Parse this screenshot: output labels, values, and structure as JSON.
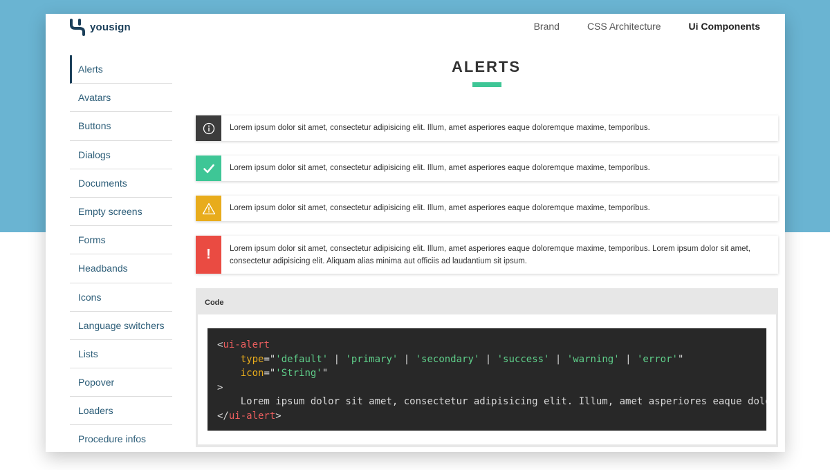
{
  "header": {
    "logo_text": "yousign",
    "nav": [
      "Brand",
      "CSS Architecture",
      "Ui Components"
    ]
  },
  "sidebar": {
    "items": [
      "Alerts",
      "Avatars",
      "Buttons",
      "Dialogs",
      "Documents",
      "Empty screens",
      "Forms",
      "Headbands",
      "Icons",
      "Language switchers",
      "Lists",
      "Popover",
      "Loaders",
      "Procedure infos"
    ]
  },
  "main": {
    "title": "ALERTS",
    "alerts": [
      {
        "type": "default",
        "icon": "info-icon",
        "text": "Lorem ipsum dolor sit amet, consectetur adipisicing elit. Illum, amet asperiores eaque doloremque maxime, temporibus."
      },
      {
        "type": "success",
        "icon": "check-icon",
        "text": "Lorem ipsum dolor sit amet, consectetur adipisicing elit. Illum, amet asperiores eaque doloremque maxime, temporibus."
      },
      {
        "type": "warning",
        "icon": "warning-icon",
        "text": "Lorem ipsum dolor sit amet, consectetur adipisicing elit. Illum, amet asperiores eaque doloremque maxime, temporibus."
      },
      {
        "type": "error",
        "icon": "exclamation-icon",
        "icon_glyph": "!",
        "text": "Lorem ipsum dolor sit amet, consectetur adipisicing elit. Illum, amet asperiores eaque doloremque maxime, temporibus. Lorem ipsum dolor sit amet, consectetur adipisicing elit. Aliquam alias minima aut officiis ad laudantium sit ipsum."
      }
    ],
    "code": {
      "label": "Code",
      "open_tag_start": "<",
      "tag_name": "ui-alert",
      "attr_type": "type",
      "type_eq": "=\"",
      "type_values": [
        "'default'",
        "'primary'",
        "'secondary'",
        "'success'",
        "'warning'",
        "'error'"
      ],
      "separator": " | ",
      "type_end": "\"",
      "attr_icon": "icon",
      "icon_eq": "=\"",
      "icon_value": "'String'",
      "icon_end": "\"",
      "open_tag_end": ">",
      "body": "Lorem ipsum dolor sit amet, consectetur adipisicing elit. Illum, amet asperiores eaque doloremque maxime, temporibus.",
      "close_tag_start": "</",
      "close_tag_end": ">"
    }
  },
  "colors": {
    "accent": "#3ec696",
    "brand": "#1b3f5a",
    "default": "#3c3c3c",
    "success": "#3ec696",
    "warning": "#e8ac1c",
    "error": "#ea4b42",
    "background_top": "#6ab4d2"
  }
}
